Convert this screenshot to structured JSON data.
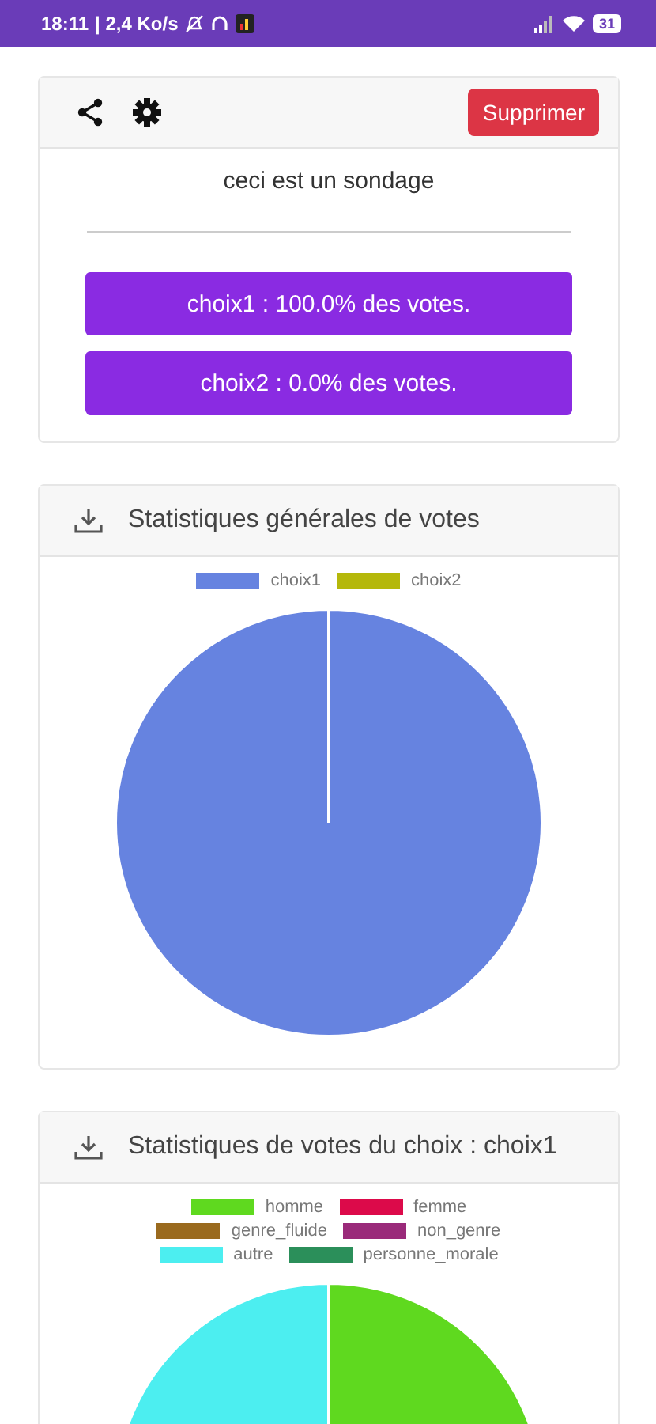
{
  "status_bar": {
    "time": "18:11",
    "speed": "| 2,4 Ko/s",
    "battery": "31"
  },
  "poll_card": {
    "delete_button": "Supprimer",
    "question": "ceci est un sondage",
    "results": [
      {
        "label": "choix1 : 100.0% des votes."
      },
      {
        "label": "choix2 : 0.0% des votes."
      }
    ]
  },
  "stat_cards": [
    {
      "title": "Statistiques générales de votes",
      "chart_data": {
        "type": "pie",
        "categories": [
          "choix1",
          "choix2"
        ],
        "values": [
          100,
          0
        ],
        "colors": [
          "#6683e0",
          "#b5b80a"
        ]
      }
    },
    {
      "title": "Statistiques de votes du choix : choix1",
      "chart_data": {
        "type": "pie",
        "categories": [
          "homme",
          "femme",
          "genre_fluide",
          "non_genre",
          "autre",
          "personne_morale"
        ],
        "values": [
          50,
          0,
          0,
          0,
          50,
          0
        ],
        "colors": [
          "#5fd91f",
          "#dc0a4a",
          "#9a6a1e",
          "#9a2a7a",
          "#4ceef0",
          "#2b8f5a"
        ]
      }
    }
  ]
}
